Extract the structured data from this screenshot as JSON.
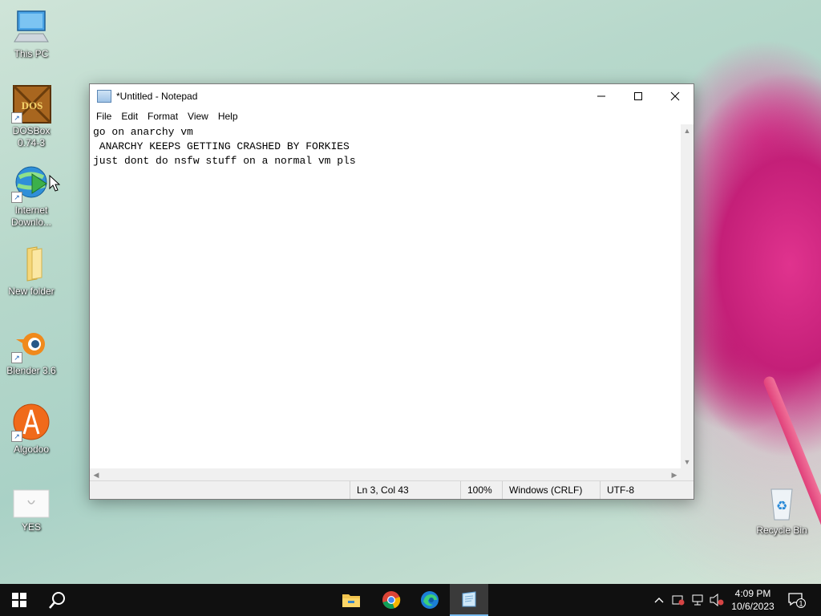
{
  "desktop": {
    "icons": [
      {
        "label": "This PC"
      },
      {
        "label": "DOSBox 0.74-3",
        "badge": "DOS"
      },
      {
        "label": "Internet Downlo..."
      },
      {
        "label": "New folder"
      },
      {
        "label": "Blender 3.6"
      },
      {
        "label": "Algodoo"
      },
      {
        "label": "YES"
      },
      {
        "label": "Recycle Bin"
      }
    ]
  },
  "notepad": {
    "title": "*Untitled - Notepad",
    "menu": [
      "File",
      "Edit",
      "Format",
      "View",
      "Help"
    ],
    "lines": [
      "go on anarchy vm",
      " ANARCHY KEEPS GETTING CRASHED BY FORKIES",
      "just dont do nsfw stuff on a normal vm pls"
    ],
    "status": {
      "position": "Ln 3, Col 43",
      "zoom": "100%",
      "line_ending": "Windows (CRLF)",
      "encoding": "UTF-8"
    }
  },
  "taskbar": {
    "time": "4:09 PM",
    "date": "10/6/2023",
    "notification_count": "1",
    "pinned": [
      "file-explorer-icon",
      "chrome-icon",
      "edge-icon",
      "notepad-icon"
    ]
  },
  "colors": {
    "taskbar": "#101010",
    "accent": "#0078d7",
    "flower": "#d6307f"
  }
}
